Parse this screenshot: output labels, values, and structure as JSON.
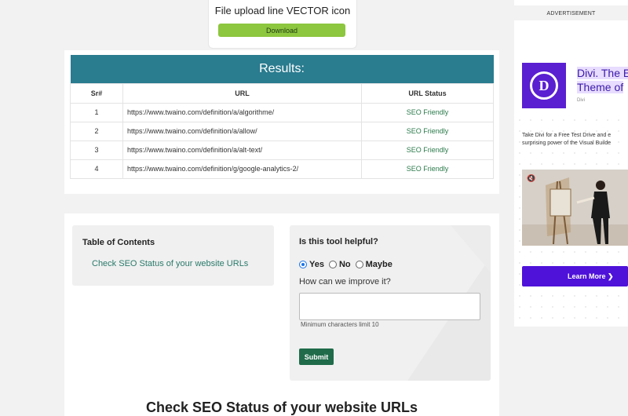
{
  "file_card": {
    "title": "File upload line VECTOR icon",
    "download_label": "Download",
    "button_color": "#8dc63f"
  },
  "results": {
    "heading": "Results:",
    "header_color": "#2a7c8f",
    "columns": [
      "Sr#",
      "URL",
      "URL Status"
    ],
    "rows": [
      {
        "sr": "1",
        "url": "https://www.twaino.com/definition/a/algorithme/",
        "status": "SEO Friendly"
      },
      {
        "sr": "2",
        "url": "https://www.twaino.com/definition/a/allow/",
        "status": "SEO Friendly"
      },
      {
        "sr": "3",
        "url": "https://www.twaino.com/definition/a/alt-text/",
        "status": "SEO Friendly"
      },
      {
        "sr": "4",
        "url": "https://www.twaino.com/definition/g/google-analytics-2/",
        "status": "SEO Friendly"
      }
    ]
  },
  "toc": {
    "title": "Table of Contents",
    "link": "Check SEO Status of your website URLs"
  },
  "feedback": {
    "question": "Is this tool helpful?",
    "options": [
      "Yes",
      "No",
      "Maybe"
    ],
    "selected": "Yes",
    "improve_label": "How can we improve it?",
    "textarea_value": "",
    "limit_note": "Minimum characters limit 10",
    "submit_label": "Submit",
    "submit_color": "#1f6b4a"
  },
  "page_heading": "Check SEO Status of your website URLs",
  "ad": {
    "label": "ADVERTISEMENT",
    "logo_letter": "D",
    "headline_line1": "Divi. The E",
    "headline_line2": "Theme of",
    "brand": "Divi",
    "copy_line1": "Take Divi for a Free Test Drive and e",
    "copy_line2": "surprising power of the Visual Builde",
    "mute_icon": "muted-speaker-icon",
    "cta_label": "Learn More",
    "cta_color": "#4e12d9"
  }
}
